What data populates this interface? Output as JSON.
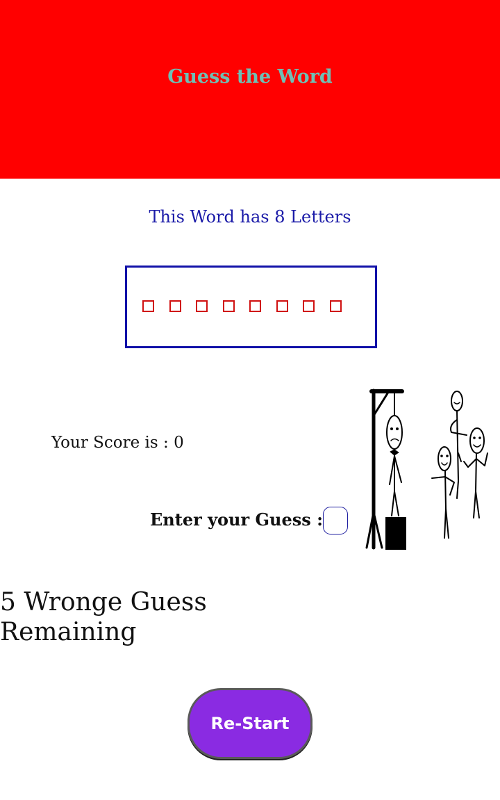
{
  "header": {
    "title": "Guess the Word",
    "bg_color": "#ff0000",
    "title_color": "#6fc0b5"
  },
  "word_info": "This Word has 8 Letters",
  "word": {
    "letter_count": 8,
    "slot_glyph": "□"
  },
  "score": {
    "label": "Your Score is : 0"
  },
  "guess": {
    "label": "Enter your Guess :",
    "value": ""
  },
  "hangman_image": {
    "icon": "hangman-illustration-icon"
  },
  "remaining": {
    "line1": "5 Wronge Guess",
    "line2": "Remaining"
  },
  "restart_button": {
    "label": "Re-Start",
    "color": "#8a2be2"
  }
}
